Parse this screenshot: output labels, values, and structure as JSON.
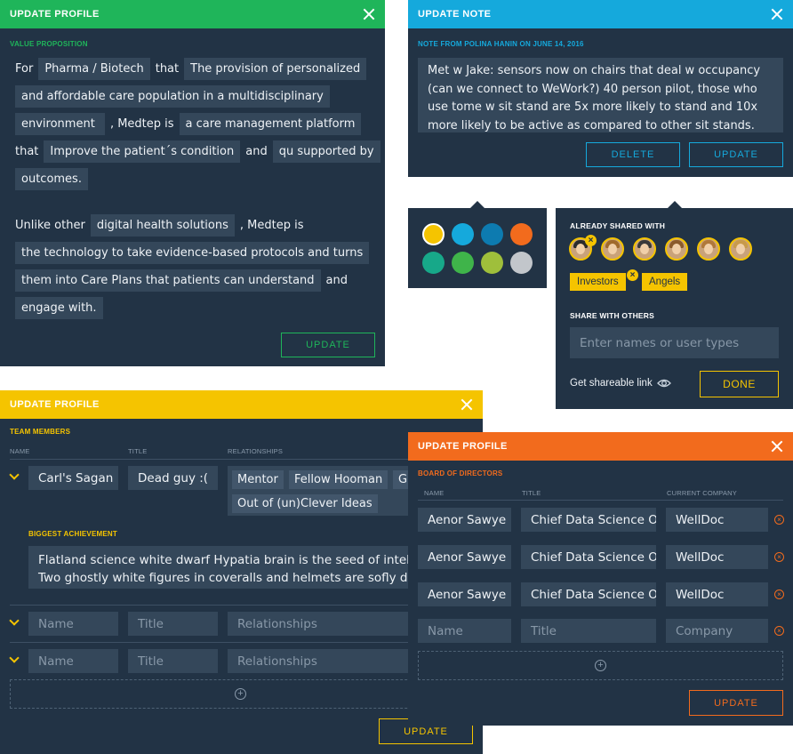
{
  "value_panel": {
    "header": "UPDATE PROFILE",
    "section": "VALUE PROPOSITION",
    "l1": {
      "t1": "For",
      "c1": "Pharma / Biotech",
      "t2": "that",
      "c2": "The provision of personalized"
    },
    "l2": {
      "c1": "and affordable care population in a multidisciplinary"
    },
    "l3": {
      "c1": "environment ",
      "t1": ", Medtep is",
      "c2": "a care management platform"
    },
    "l4": {
      "t1": "that",
      "c1": "Improve the patient´s condition",
      "t2": "and",
      "c2": "qu supported by"
    },
    "l5": {
      "c1": "outcomes."
    },
    "l6": {
      "t1": "Unlike other",
      "c1": "digital health solutions",
      "t2": ", Medtep is"
    },
    "l7": {
      "c1": "the technology to take evidence-based protocols and turns"
    },
    "l8": {
      "c1": "them into Care Plans that patients can understand",
      "t1": "and"
    },
    "l9": {
      "c1": "engage with."
    },
    "button": "UPDATE"
  },
  "note_panel": {
    "header": "UPDATE NOTE",
    "meta": "NOTE FROM POLINA HANIN ON JUNE 14, 2016",
    "text": "Met w Jake: sensors now on chairs that deal w occupancy (can we connect to WeWork?) 40 person pilot, those who use tome w sit stand are 5x more likely to stand and 10x more likely to be active as compared to other sit stands.",
    "delete_label": "DELETE",
    "update_label": "UPDATE"
  },
  "colors": {
    "green": "#1fb55a",
    "blue": "#15a9dc",
    "yellow": "#f5c400",
    "orange": "#f26b1d",
    "panel": "#223345",
    "swatches": [
      "#f5c400",
      "#15a9dc",
      "#0d7bb0",
      "#f26b1d",
      "#17a889",
      "#3fb44a",
      "#9fbf3b",
      "#c2c6cb"
    ]
  },
  "share_panel": {
    "already_label": "ALREADY SHARED WITH",
    "tags": [
      "Investors",
      "Angels"
    ],
    "share_label": "SHARE WITH OTHERS",
    "placeholder": "Enter names or user types",
    "link_label": "Get shareable link",
    "done_label": "DONE"
  },
  "team_panel": {
    "header": "UPDATE PROFILE",
    "section": "TEAM MEMBERS",
    "col_name": "NAME",
    "col_title": "TITLE",
    "col_rel": "RELATIONSHIPS",
    "member": {
      "name": "Carl's Sagan",
      "title": "Dead guy :(",
      "relationships": [
        "Mentor",
        "Fellow Hooman",
        "G",
        "Out of (un)Clever Ideas"
      ]
    },
    "achievement_label": "BIGGEST ACHIEVEMENT",
    "achievement_l1": "Flatland science white dwarf Hypatia brain is the seed of intellig",
    "achievement_l2": "Two ghostly white figures in coveralls and helmets are sofly dar",
    "ph_name": "Name",
    "ph_title": "Title",
    "ph_rel": "Relationships",
    "button": "UPDATE"
  },
  "board_panel": {
    "header": "UPDATE PROFILE",
    "section": "BOARD OF DIRECTORS",
    "col_name": "NAME",
    "col_title": "TITLE",
    "col_company": "CURRENT COMPANY",
    "rows": [
      {
        "name": "Aenor Sawye",
        "title": "Chief Data Science O",
        "company": "WellDoc"
      },
      {
        "name": "Aenor Sawye",
        "title": "Chief Data Science O",
        "company": "WellDoc"
      },
      {
        "name": "Aenor Sawye",
        "title": "Chief Data Science O",
        "company": "WellDoc"
      }
    ],
    "ph_name": "Name",
    "ph_title": "Title",
    "ph_company": "Company",
    "button": "UPDATE"
  }
}
